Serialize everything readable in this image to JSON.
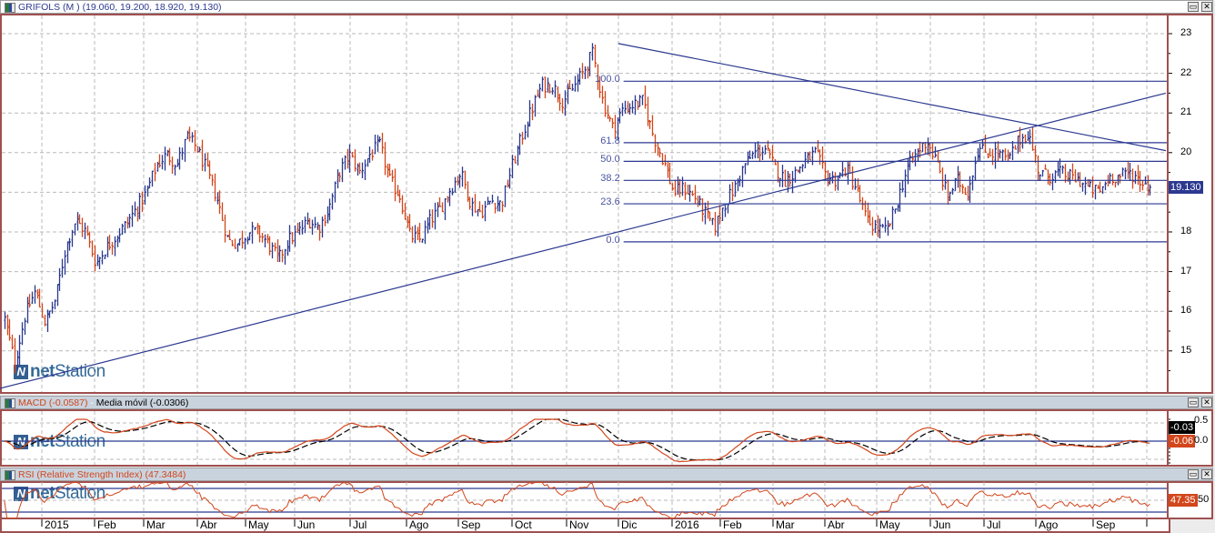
{
  "window": {
    "title": "GRIFOLS (M ) (19.060, 19.200, 18.920, 19.130)",
    "restore_label": "▭",
    "close_label": "✕"
  },
  "macd_panel": {
    "title_macd": "MACD (-0.0587)",
    "separator": " - ",
    "title_signal": "Media móvil (-0.0306)",
    "signal_badge": "-0.03",
    "macd_badge": "-0.06",
    "ticks": [
      "0.5",
      "0.0"
    ]
  },
  "rsi_panel": {
    "title": "RSI (Relative Strength Index) (47.3484)",
    "badge": "47.35",
    "ticks": [
      "50"
    ]
  },
  "watermark": {
    "brand_a": "net",
    "brand_b": "Station"
  },
  "colors": {
    "up": "#2b3990",
    "down": "#d2461b",
    "frame": "#a05050",
    "grid": "#b9b9b9",
    "signal": "#000000",
    "badge_price": "#2b3990",
    "badge_signal": "#000000",
    "badge_macd": "#d2461b"
  },
  "chart_data": {
    "type": "ohlc",
    "title": "GRIFOLS (M )",
    "last_ohlc": {
      "open": 19.06,
      "high": 19.2,
      "low": 18.92,
      "close": 19.13
    },
    "last_price_label": "19.130",
    "ylim": [
      14.05,
      23.45
    ],
    "y_ticks": [
      "15",
      "16",
      "17",
      "18",
      "19",
      "20",
      "21",
      "22",
      "23"
    ],
    "x_ticks": [
      "2015",
      "Feb",
      "Mar",
      "Abr",
      "May",
      "Jun",
      "Jul",
      "Ago",
      "Sep",
      "Oct",
      "Nov",
      "Dic",
      "2016",
      "Feb",
      "Mar",
      "Abr",
      "May",
      "Jun",
      "Jul",
      "Ago",
      "Sep"
    ],
    "series_start": "2014-12-10",
    "series_end": "2016-10-03",
    "closes": [
      15.8,
      14.7,
      15.9,
      16.5,
      15.7,
      16.3,
      17.6,
      18.3,
      18.0,
      17.2,
      17.6,
      17.9,
      18.2,
      18.6,
      19.0,
      19.7,
      19.95,
      19.7,
      20.4,
      20.1,
      19.5,
      18.8,
      17.8,
      17.7,
      18.0,
      18.0,
      17.7,
      17.3,
      17.8,
      18.0,
      18.3,
      18.1,
      18.6,
      19.5,
      19.95,
      19.5,
      19.95,
      20.2,
      19.3,
      18.9,
      17.9,
      17.8,
      18.3,
      18.6,
      19.1,
      19.5,
      18.7,
      18.5,
      18.8,
      18.7,
      19.6,
      20.4,
      21.1,
      21.7,
      21.7,
      21.3,
      21.6,
      22.0,
      22.5,
      21.3,
      20.6,
      21.1,
      21.2,
      21.3,
      20.4,
      19.8,
      19.0,
      19.1,
      18.9,
      18.5,
      18.1,
      18.7,
      19.1,
      19.7,
      20.0,
      20.1,
      19.6,
      19.3,
      19.5,
      19.8,
      20.0,
      19.4,
      19.3,
      19.6,
      19.1,
      18.3,
      18.1,
      18.0,
      18.7,
      19.6,
      20.0,
      20.3,
      19.7,
      18.9,
      19.3,
      19.0,
      20.1,
      20.0,
      20.0,
      19.8,
      20.3,
      20.5,
      19.5,
      19.4,
      19.5,
      19.4,
      19.3,
      19.1,
      19.0,
      19.4,
      19.4,
      19.5,
      19.3,
      19.13
    ],
    "fibonacci": {
      "start_date": "2015-12-04",
      "levels": [
        {
          "label": "100.0",
          "value": 21.8
        },
        {
          "label": "61.8",
          "value": 20.25
        },
        {
          "label": "50.0",
          "value": 19.78
        },
        {
          "label": "38.2",
          "value": 19.3
        },
        {
          "label": "23.6",
          "value": 18.71
        },
        {
          "label": "0.0",
          "value": 17.75
        }
      ]
    },
    "trendlines": [
      {
        "name": "support",
        "start": {
          "date": "2014-12-07",
          "price": 14.05
        },
        "end": {
          "date": "2016-10-12",
          "price": 21.5
        }
      },
      {
        "name": "resistance",
        "start": {
          "date": "2015-12-01",
          "price": 22.75
        },
        "end": {
          "date": "2016-10-12",
          "price": 20.05
        }
      }
    ],
    "indicators": {
      "macd": {
        "fast": 12,
        "slow": 26,
        "signal": 9,
        "ylim": [
          -0.6,
          0.6
        ]
      },
      "rsi": {
        "period": 14,
        "levels": [
          30,
          50,
          70
        ]
      }
    }
  }
}
